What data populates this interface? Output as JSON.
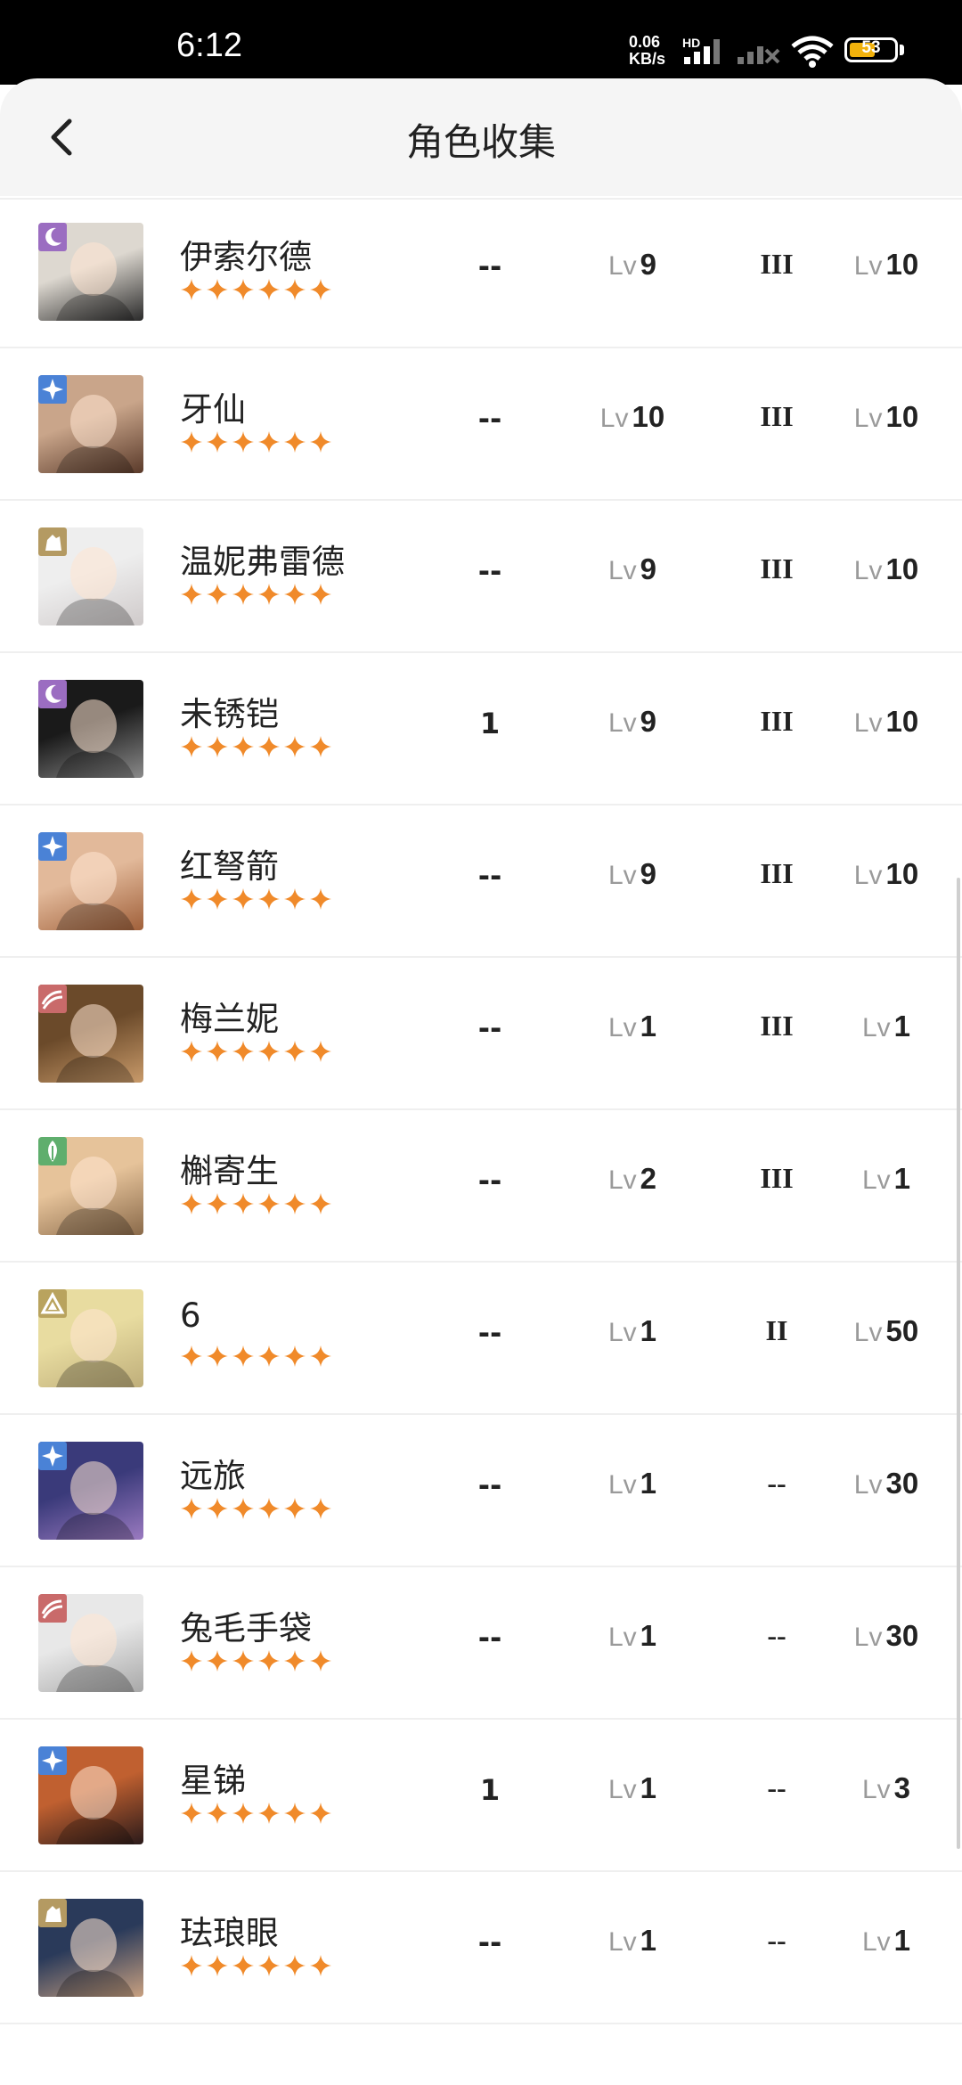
{
  "status_bar": {
    "time": "6:12",
    "net_speed_value": "0.06",
    "net_speed_unit": "KB/s",
    "hd_label": "HD",
    "battery": "53"
  },
  "header": {
    "title": "角色收集"
  },
  "level_prefix": "Lv",
  "element_colors": {
    "purple": "#9b6dc1",
    "blue": "#4a82d6",
    "gold": "#b49a62",
    "red": "#c96a6a",
    "green": "#5fae6d",
    "yellow": "#b9a35e"
  },
  "star_color": "#f08a2a",
  "rows": [
    {
      "name": "伊索尔德",
      "element_icon": "moon-icon",
      "element_color": "#9b6dc1",
      "stars": 6,
      "count": "--",
      "level": "9",
      "tier": "III",
      "skill_level": "10",
      "portrait_colors": [
        "#ddd8d0",
        "#2a2a2a"
      ]
    },
    {
      "name": "牙仙",
      "element_icon": "star-icon",
      "element_color": "#4a82d6",
      "stars": 6,
      "count": "--",
      "level": "10",
      "tier": "III",
      "skill_level": "10",
      "portrait_colors": [
        "#c9a58a",
        "#5a3a2a"
      ]
    },
    {
      "name": "温妮弗雷德",
      "element_icon": "beast-icon",
      "element_color": "#b49a62",
      "stars": 6,
      "count": "--",
      "level": "9",
      "tier": "III",
      "skill_level": "10",
      "portrait_colors": [
        "#eeeeee",
        "#cfcaca"
      ]
    },
    {
      "name": "未锈铠",
      "element_icon": "moon-icon",
      "element_color": "#9b6dc1",
      "stars": 6,
      "count": "1",
      "level": "9",
      "tier": "III",
      "skill_level": "10",
      "portrait_colors": [
        "#1a1a1a",
        "#8a8a8a"
      ]
    },
    {
      "name": "红弩箭",
      "element_icon": "star-icon",
      "element_color": "#4a82d6",
      "stars": 6,
      "count": "--",
      "level": "9",
      "tier": "III",
      "skill_level": "10",
      "portrait_colors": [
        "#e2b99a",
        "#a0603a"
      ]
    },
    {
      "name": "梅兰妮",
      "element_icon": "wave-icon",
      "element_color": "#c96a6a",
      "stars": 6,
      "count": "--",
      "level": "1",
      "tier": "III",
      "skill_level": "1",
      "portrait_colors": [
        "#6b4a2a",
        "#c89a6a"
      ]
    },
    {
      "name": "槲寄生",
      "element_icon": "leaf-icon",
      "element_color": "#5fae6d",
      "stars": 6,
      "count": "--",
      "level": "2",
      "tier": "III",
      "skill_level": "1",
      "portrait_colors": [
        "#e6c39a",
        "#8a6a4a"
      ]
    },
    {
      "name": "6",
      "element_icon": "mineral-icon",
      "element_color": "#b9a35e",
      "stars": 6,
      "count": "--",
      "level": "1",
      "tier": "II",
      "skill_level": "50",
      "portrait_colors": [
        "#e8dca0",
        "#bfae7a"
      ]
    },
    {
      "name": "远旅",
      "element_icon": "star-icon",
      "element_color": "#4a82d6",
      "stars": 6,
      "count": "--",
      "level": "1",
      "tier": "--",
      "skill_level": "30",
      "portrait_colors": [
        "#3a3a7a",
        "#9a7ac0"
      ]
    },
    {
      "name": "兔毛手袋",
      "element_icon": "wave-icon",
      "element_color": "#c96a6a",
      "stars": 6,
      "count": "--",
      "level": "1",
      "tier": "--",
      "skill_level": "30",
      "portrait_colors": [
        "#e8e8e8",
        "#a8a8a8"
      ]
    },
    {
      "name": "星锑",
      "element_icon": "star-icon",
      "element_color": "#4a82d6",
      "stars": 6,
      "count": "1",
      "level": "1",
      "tier": "--",
      "skill_level": "3",
      "portrait_colors": [
        "#c06030",
        "#2a1a1a"
      ]
    },
    {
      "name": "珐琅眼",
      "element_icon": "beast-icon",
      "element_color": "#b49a62",
      "stars": 6,
      "count": "--",
      "level": "1",
      "tier": "--",
      "skill_level": "1",
      "portrait_colors": [
        "#2a3a5a",
        "#c8a080"
      ]
    }
  ]
}
